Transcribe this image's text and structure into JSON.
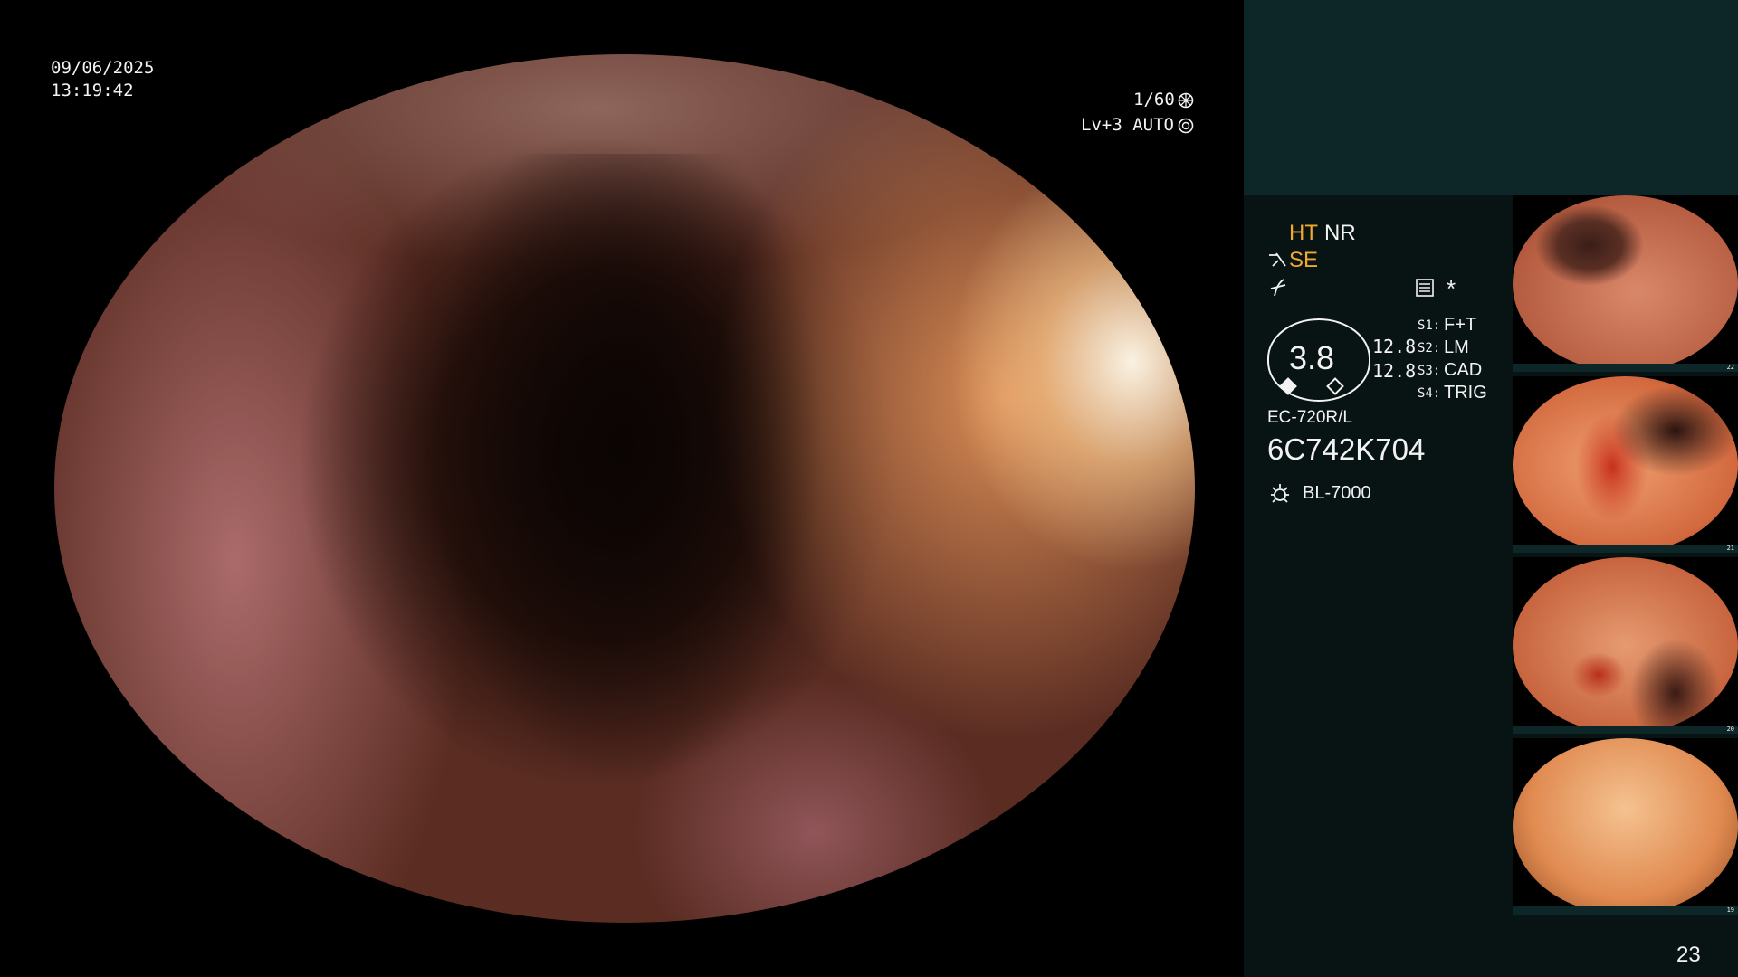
{
  "overlay": {
    "date": "09/06/2025",
    "time": "13:19:42",
    "shutter": "1/60",
    "shutter_icon": "shutter-icon",
    "level_mode": "Lv+3 AUTO",
    "auto_icon": "iris-icon"
  },
  "panel": {
    "ht": "HT",
    "nr": "NR",
    "se": "SE",
    "se_icon": "scissor-icon",
    "edge_icon": "edge-enhance-icon",
    "memory_icon": "memory-icon",
    "star": "*",
    "gauge_value": "3.8",
    "readout_1": "12.8",
    "readout_2": "12.8",
    "switches": [
      {
        "key": "S1:",
        "value": "F+T"
      },
      {
        "key": "S2:",
        "value": "LM"
      },
      {
        "key": "S3:",
        "value": "CAD"
      },
      {
        "key": "S4:",
        "value": "TRIG"
      }
    ],
    "scope_model": "EC-720R/L",
    "serial": "6C742K704",
    "light_icon": "light-source-icon",
    "light_source": "BL-7000",
    "page_number": "23",
    "colors": {
      "highlight": "#f0a830",
      "panel_top": "#0d2729",
      "panel_bottom": "#081314"
    }
  },
  "thumbnails": [
    {
      "number": "22"
    },
    {
      "number": "21"
    },
    {
      "number": "20"
    },
    {
      "number": "19"
    }
  ]
}
